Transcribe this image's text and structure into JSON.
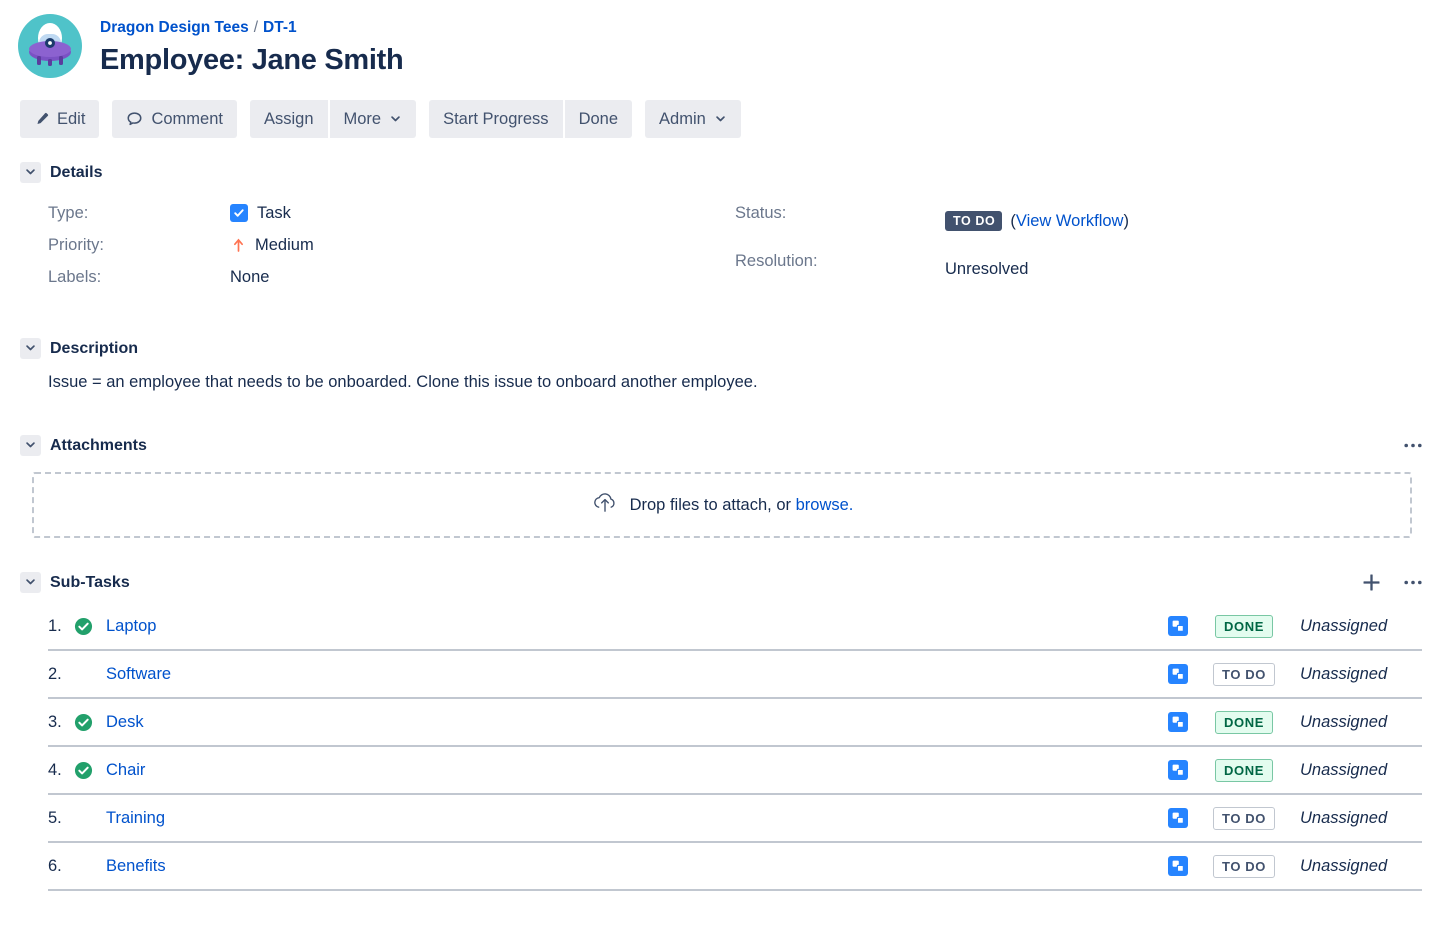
{
  "header": {
    "avatar_name": "project-avatar-ufo",
    "avatar_colors": {
      "ring": "#4FC3C9",
      "saucer": "#7B52C4",
      "dome": "#BFD9F2",
      "eye": "#1B3A6B"
    },
    "breadcrumb": {
      "project": "Dragon Design Tees",
      "separator": "/",
      "issue_key": "DT-1"
    },
    "title": "Employee: Jane Smith"
  },
  "toolbar": {
    "edit_label": "Edit",
    "comment_label": "Comment",
    "assign_label": "Assign",
    "more_label": "More",
    "start_progress_label": "Start Progress",
    "done_label": "Done",
    "admin_label": "Admin"
  },
  "details": {
    "section_title": "Details",
    "type_label": "Type:",
    "type_value": "Task",
    "priority_label": "Priority:",
    "priority_value": "Medium",
    "labels_label": "Labels:",
    "labels_value": "None",
    "status_label": "Status:",
    "status_value": "TO DO",
    "view_workflow_open": "(",
    "view_workflow_label": "View Workflow",
    "view_workflow_close": ")",
    "resolution_label": "Resolution:",
    "resolution_value": "Unresolved"
  },
  "description": {
    "section_title": "Description",
    "body": "Issue = an employee that needs to be onboarded. Clone this issue to onboard another employee."
  },
  "attachments": {
    "section_title": "Attachments",
    "drop_text": "Drop files to attach, or",
    "browse_label": "browse.",
    "more_actions_label": "•••"
  },
  "subtasks": {
    "section_title": "Sub-Tasks",
    "add_label": "+",
    "more_actions_label": "•••",
    "rows": [
      {
        "num": "1.",
        "done": true,
        "name": "Laptop",
        "status": "DONE",
        "assignee": "Unassigned"
      },
      {
        "num": "2.",
        "done": false,
        "name": "Software",
        "status": "TO DO",
        "assignee": "Unassigned"
      },
      {
        "num": "3.",
        "done": true,
        "name": "Desk",
        "status": "DONE",
        "assignee": "Unassigned"
      },
      {
        "num": "4.",
        "done": true,
        "name": "Chair",
        "status": "DONE",
        "assignee": "Unassigned"
      },
      {
        "num": "5.",
        "done": false,
        "name": "Training",
        "status": "TO DO",
        "assignee": "Unassigned"
      },
      {
        "num": "6.",
        "done": false,
        "name": "Benefits",
        "status": "TO DO",
        "assignee": "Unassigned"
      }
    ]
  },
  "colors": {
    "link": "#0052CC",
    "text": "#172B4D",
    "muted": "#6B778C",
    "button_bg": "#EBECF0",
    "type_blue": "#2684FF",
    "priority_orange": "#FF7452",
    "status_todo_bg": "#42526E",
    "done_green": "#006644",
    "check_green": "#22A06B",
    "divider": "#C1C7D0"
  }
}
